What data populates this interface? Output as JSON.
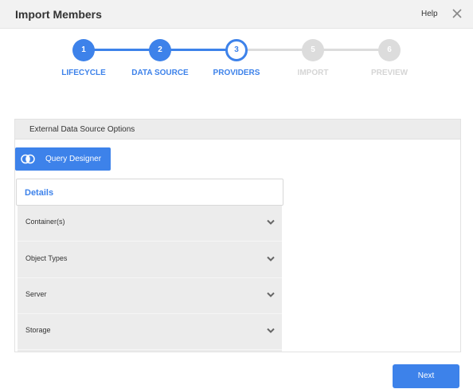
{
  "header": {
    "title": "Import Members",
    "help_label": "Help",
    "close_icon": "close-icon"
  },
  "colors": {
    "accent": "#3d82ea",
    "inactive": "#dcdcdc",
    "panel_bg": "#ececec"
  },
  "stepper": {
    "steps": [
      {
        "number": "1",
        "label": "LIFECYCLE",
        "state": "done"
      },
      {
        "number": "2",
        "label": "DATA SOURCE",
        "state": "done"
      },
      {
        "number": "3",
        "label": "PROVIDERS",
        "state": "current"
      },
      {
        "number": "5",
        "label": "IMPORT",
        "state": "todo"
      },
      {
        "number": "6",
        "label": "PREVIEW",
        "state": "todo"
      }
    ]
  },
  "panel": {
    "title": "External Data Source Options",
    "query_designer_label": "Query Designer",
    "query_designer_icon": "venn-circles-icon",
    "details_title": "Details",
    "sections": [
      {
        "label": "Container(s)",
        "icon": "chevron-down-icon"
      },
      {
        "label": "Object Types",
        "icon": "chevron-down-icon"
      },
      {
        "label": "Server",
        "icon": "chevron-down-icon"
      },
      {
        "label": "Storage",
        "icon": "chevron-down-icon"
      }
    ]
  },
  "footer": {
    "next_label": "Next"
  }
}
